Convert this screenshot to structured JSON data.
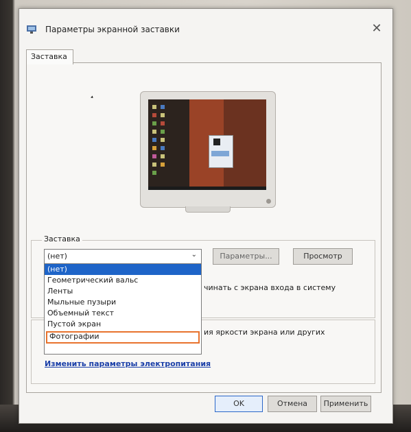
{
  "window": {
    "title": "Параметры экранной заставки",
    "close_glyph": "✕"
  },
  "tabs": [
    {
      "label": "Заставка"
    }
  ],
  "screensaver": {
    "group_label": "Заставка",
    "selected_value": "(нет)",
    "options": [
      "(нет)",
      "Геометрический вальс",
      "Ленты",
      "Мыльные пузыри",
      "Объемный текст",
      "Пустой экран",
      "Фотографии"
    ],
    "highlighted_option": "Фотографии",
    "parameters_button": "Параметры...",
    "preview_button": "Просмотр",
    "login_checkbox_text": "чинать с экрана входа в систему"
  },
  "power": {
    "partial_text": "ия яркости экрана или других",
    "link": "Изменить параметры электропитания"
  },
  "footer": {
    "ok": "OK",
    "cancel": "Отмена",
    "apply": "Применить"
  },
  "colors": {
    "selection": "#1e64c8",
    "highlight_frame": "#e8722c",
    "link": "#1a3fa8"
  },
  "icons": {
    "app": "screensaver-settings-icon",
    "close": "close-icon",
    "dropdown": "chevron-down-icon"
  }
}
